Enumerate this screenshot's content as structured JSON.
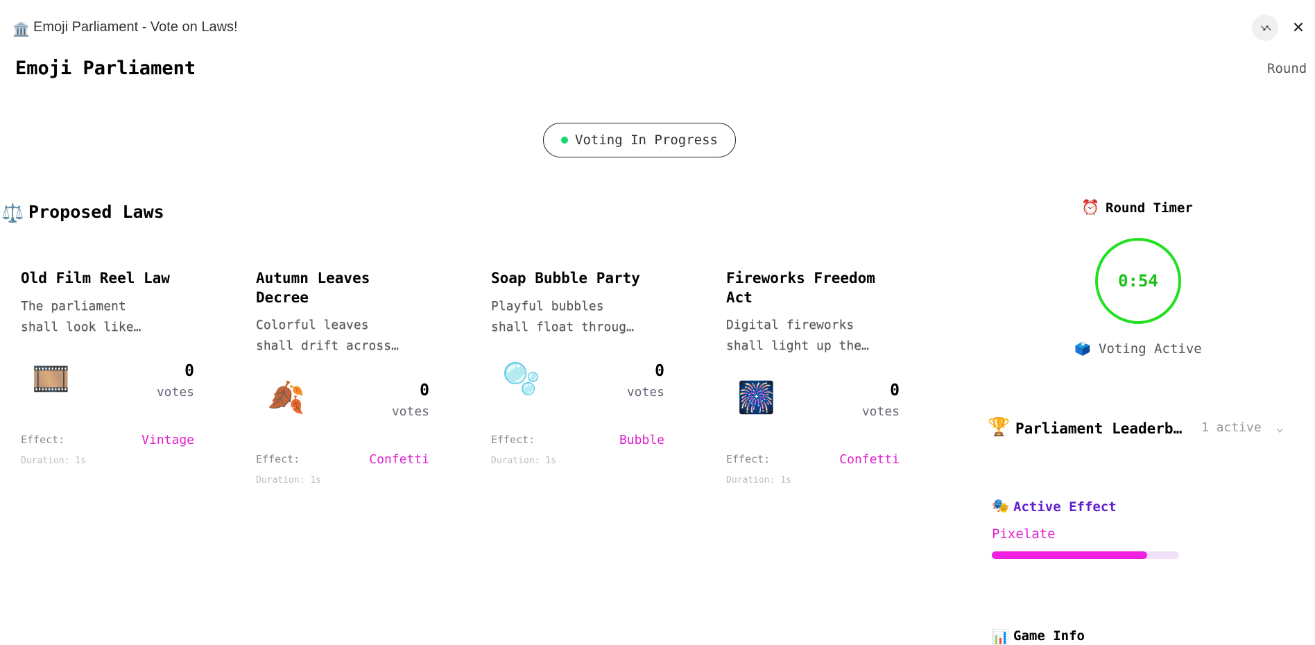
{
  "window": {
    "icon": "🏛️",
    "title": "Emoji Parliament - Vote on Laws!",
    "minimize_icon": "↘↖",
    "close_icon": "✕"
  },
  "header": {
    "app_title": "Emoji Parliament",
    "round_label": "Round"
  },
  "status": {
    "label": "Voting In Progress",
    "dot_color": "#14d870"
  },
  "laws_section": {
    "icon": "⚖️",
    "title": "Proposed Laws"
  },
  "laws": [
    {
      "title": "Old Film Reel Law",
      "desc_line1": "The parliament",
      "desc_line2": "shall look like…",
      "emoji": "🎞️",
      "votes": "0",
      "votes_label": "votes",
      "effect_label": "Effect:",
      "effect_value": "Vintage",
      "duration": "Duration: 1s"
    },
    {
      "title": "Autumn Leaves Decree",
      "desc_line1": "Colorful leaves",
      "desc_line2": "shall drift across…",
      "emoji": "🍂",
      "votes": "0",
      "votes_label": "votes",
      "effect_label": "Effect:",
      "effect_value": "Confetti",
      "duration": "Duration: 1s"
    },
    {
      "title": "Soap Bubble Party",
      "desc_line1": "Playful bubbles",
      "desc_line2": "shall float throug…",
      "emoji": "🫧",
      "votes": "0",
      "votes_label": "votes",
      "effect_label": "Effect:",
      "effect_value": "Bubble",
      "duration": "Duration: 1s"
    },
    {
      "title": "Fireworks Freedom Act",
      "desc_line1": "Digital fireworks",
      "desc_line2": "shall light up the…",
      "emoji": "🎆",
      "votes": "0",
      "votes_label": "votes",
      "effect_label": "Effect:",
      "effect_value": "Confetti",
      "duration": "Duration: 1s"
    }
  ],
  "timer": {
    "icon": "⏰",
    "title": "Round Timer",
    "value": "0:54",
    "status_icon": "🗳️",
    "status": "Voting Active",
    "ring_color": "#20e020"
  },
  "leaderboard": {
    "icon": "🏆",
    "title": "Parliament Leaderb…",
    "count": "1 active",
    "chevron_icon": "⌄"
  },
  "active_effect": {
    "icon": "🎭",
    "title": "Active Effect",
    "name": "Pixelate",
    "progress": 0.83,
    "color": "#f020e0"
  },
  "stats": {
    "icon": "📊",
    "title": "Game Info"
  }
}
